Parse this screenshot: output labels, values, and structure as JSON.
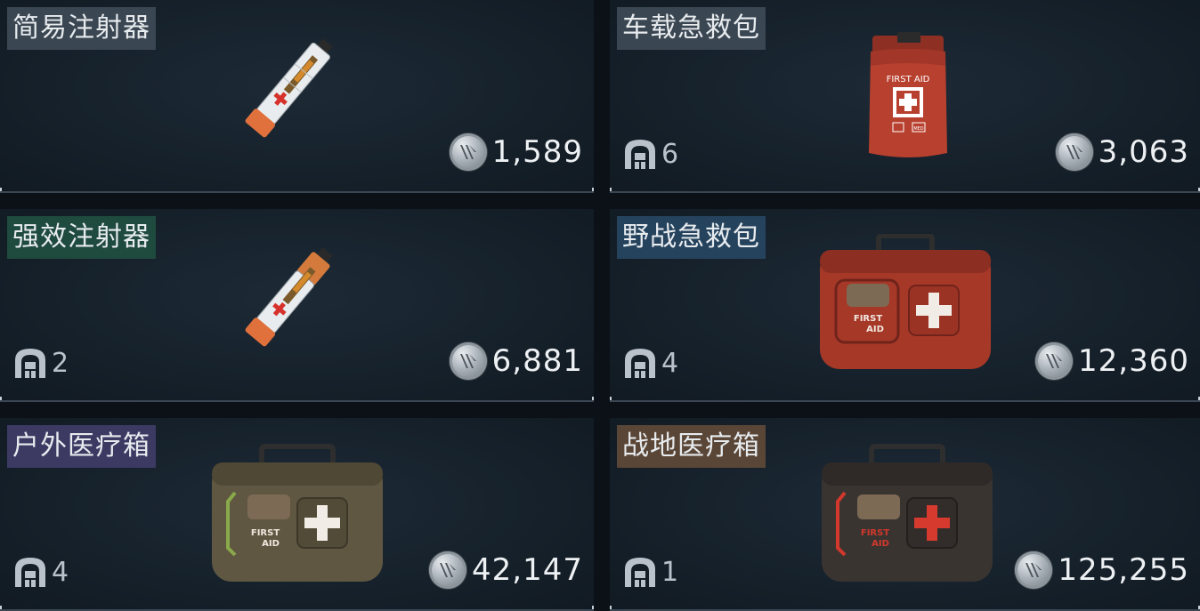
{
  "items": [
    {
      "name": "简易注射器",
      "quantity": "",
      "price": "1,589",
      "rarity_color": "#3a4652",
      "art": "syringe-basic-icon"
    },
    {
      "name": "车载急救包",
      "quantity": "6",
      "price": "3,063",
      "rarity_color": "#3a4652",
      "art": "vehicle-first-aid-bag-icon"
    },
    {
      "name": "强效注射器",
      "quantity": "2",
      "price": "6,881",
      "rarity_color": "#1f4a3e",
      "art": "syringe-strong-icon"
    },
    {
      "name": "野战急救包",
      "quantity": "4",
      "price": "12,360",
      "rarity_color": "#26435e",
      "art": "field-first-aid-kit-icon"
    },
    {
      "name": "户外医疗箱",
      "quantity": "4",
      "price": "42,147",
      "rarity_color": "#3c3a63",
      "art": "outdoor-medical-box-icon"
    },
    {
      "name": "战地医疗箱",
      "quantity": "1",
      "price": "125,255",
      "rarity_color": "#5a4636",
      "art": "battlefield-medical-box-icon"
    }
  ],
  "kit_text": {
    "line1": "FIRST",
    "line2": "AID",
    "bag_text": "FIRST AID",
    "bag_tag": "MED"
  }
}
